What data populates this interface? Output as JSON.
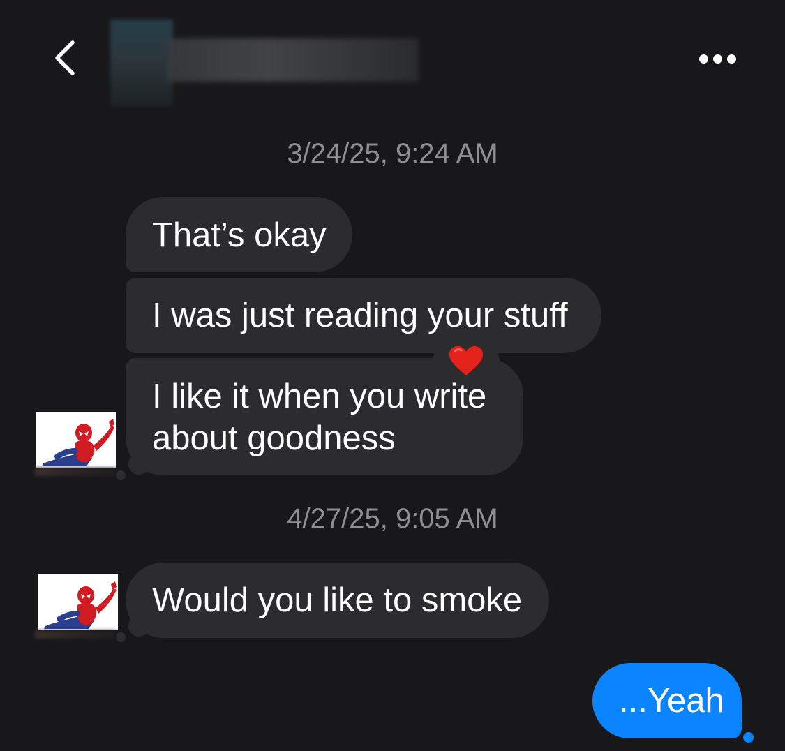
{
  "header": {
    "back_icon": "chevron-left-icon",
    "more_icon": "ellipsis-icon",
    "contact_name_blurred": true
  },
  "colors": {
    "background": "#18181b",
    "incoming_bubble": "#2c2c2e",
    "outgoing_bubble": "#0a84ff",
    "timestamp": "#8e8e93",
    "reaction": "#e5231d"
  },
  "conversation": {
    "timestamp_1": "3/24/25, 9:24 AM",
    "timestamp_2": "4/27/25, 9:05 AM",
    "messages": [
      {
        "direction": "incoming",
        "text": "That’s okay"
      },
      {
        "direction": "incoming",
        "text": "I was just reading your stuff"
      },
      {
        "direction": "incoming",
        "line1": "I like it when you write",
        "line2": "about goodness",
        "reaction": "heart-icon"
      },
      {
        "direction": "incoming",
        "text": "Would you like to smoke"
      },
      {
        "direction": "outgoing",
        "text": "...Yeah"
      }
    ],
    "sender_avatar_icon": "spider-man-avatar-icon"
  }
}
